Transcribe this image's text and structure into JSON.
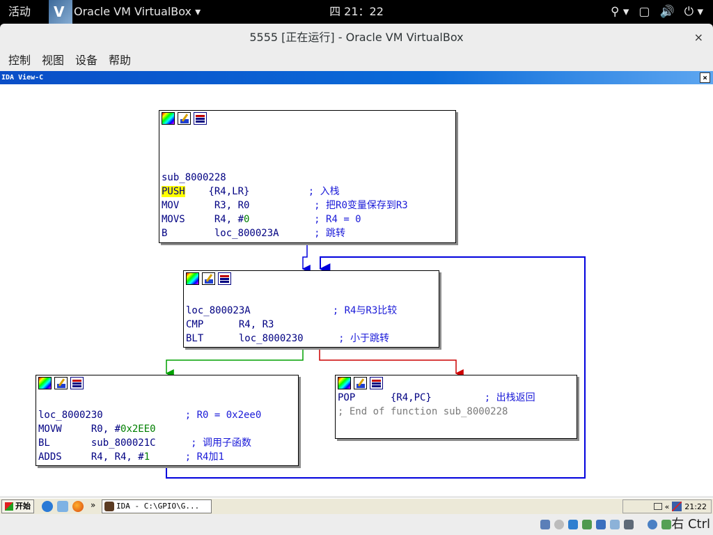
{
  "topbar": {
    "activities": "活动",
    "app_name": "Oracle VM VirtualBox ▾",
    "clock": "四 21：22",
    "indicators": [
      "accessibility-icon",
      "window-icon",
      "volume-icon",
      "power-icon"
    ]
  },
  "window": {
    "title": "5555 [正在运行] - Oracle VM VirtualBox",
    "close_label": "×",
    "menu": [
      "控制",
      "视图",
      "设备",
      "帮助"
    ]
  },
  "ida": {
    "view_title": "IDA View-C",
    "close_label": "×",
    "nodes": {
      "entry": {
        "label": "sub_8000228",
        "push_mnem": "PUSH",
        "push_ops": "    {R4,LR}          ",
        "push_cmt": "; 入栈",
        "mov": "MOV      R3, R0           ",
        "mov_cmt": "; 把R0变量保存到R3",
        "movs_pre": "MOVS     R4, #",
        "movs_num": "0",
        "movs_post": "           ",
        "movs_cmt": "; R4 = 0",
        "b": "B        loc_800023A      ",
        "b_cmt": "; 跳转"
      },
      "loop": {
        "label": "loc_800023A              ",
        "label_cmt": "; R4与R3比较",
        "cmp": "CMP      R4, R3",
        "blt": "BLT      loc_8000230      ",
        "blt_cmt": "; 小于跳转"
      },
      "body": {
        "label": "loc_8000230              ",
        "label_cmt": "; R0 = 0x2ee0",
        "movw_pre": "MOVW     R0, #",
        "movw_num": "0x2EE0",
        "bl": "BL       sub_800021C      ",
        "bl_cmt": "; 调用子函数",
        "adds_pre": "ADDS     R4, R4, #",
        "adds_num": "1",
        "adds_post": "      ",
        "adds_cmt": "; R4加1"
      },
      "exit": {
        "pop": "POP      {R4,PC}         ",
        "pop_cmt": "; 出栈返回",
        "end": "; End of function sub_8000228"
      }
    }
  },
  "xp": {
    "start_label": "开始",
    "task_label": "IDA - C:\\GPIO\\G...",
    "tray_time": "21:22"
  },
  "vbox_status": {
    "host_key": "右 Ctrl"
  },
  "colors": {
    "ida_text": "#000082",
    "ida_comment": "#1a1ad8",
    "edge_false": "#cc0000",
    "edge_true": "#00a000",
    "edge_plain": "#0000dd"
  }
}
